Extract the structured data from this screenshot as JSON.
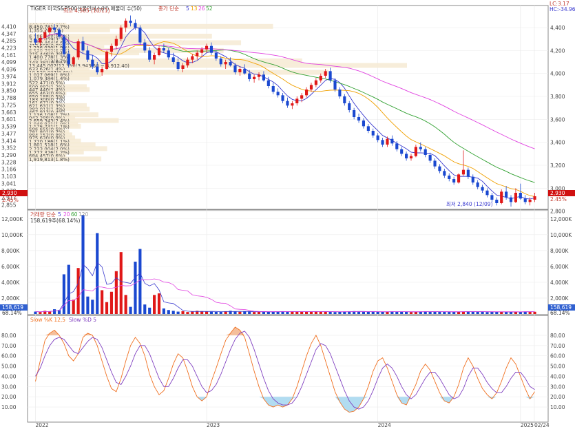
{
  "chart_data": {
    "type": "candlestick",
    "title": "TIGER 미국S&P500선물인버스(H) 매물대 수(50)",
    "price_legend": {
      "label": "종가 단순",
      "periods": [
        "5",
        "13",
        "26",
        "52"
      ]
    },
    "corner_info": {
      "lc": "LC:3.17",
      "hc": "HC:-34.96"
    },
    "price_axis": {
      "ylim": [
        2840,
        4520
      ],
      "right_ticks": [
        "4,400",
        "4,200",
        "4,000",
        "3,800",
        "3,600",
        "3,400",
        "3,200",
        "3,000",
        "2,800"
      ],
      "left_ticks": [
        "4,410",
        "4,347",
        "4,285",
        "4,223",
        "4,161",
        "4,099",
        "4,036",
        "3,974",
        "3,912",
        "3,850",
        "3,788",
        "3,725",
        "3,663",
        "3,601",
        "3,539",
        "3,477",
        "3,414",
        "3,352",
        "3,290",
        "3,228",
        "3,166",
        "3,103",
        "3,041",
        "2,979",
        "2,917",
        "2,855"
      ],
      "current_price_badge": "2,930",
      "current_change": "2.45%"
    },
    "x_axis": {
      "labels": [
        "2022",
        "2023",
        "2024",
        "2025",
        "02/24"
      ]
    },
    "annotations": {
      "high": "최고 4,505 (10/11)",
      "low": "최저 2,840 (12/09)"
    },
    "volume_profile": [
      {
        "price": 4420,
        "text": "402,150(0.6%)"
      },
      {
        "price": 4380,
        "text": "1,355,7(2.1%)"
      },
      {
        "price": 4410,
        "text": "8,450,781(7.7%)"
      },
      {
        "price": 4325,
        "text": "6,185,468(5.6%)"
      },
      {
        "price": 4300,
        "text": "3,422,059(3.3%)"
      },
      {
        "price": 4268,
        "text": "7,199,464(6.6%)"
      },
      {
        "price": 4245,
        "text": "413,609(0.6%)"
      },
      {
        "price": 4225,
        "text": "1,236,030(1.9%)"
      },
      {
        "price": 4200,
        "text": "6,530,782(6.0%)"
      },
      {
        "price": 4180,
        "text": "3,450,448(3.1%)"
      },
      {
        "price": 4170,
        "text": "315,446(0.3%)"
      },
      {
        "price": 4145,
        "text": "1,400,778(1.3%)"
      },
      {
        "price": 4110,
        "text": "9,525,583(8.7%)"
      },
      {
        "price": 4098,
        "text": "143,381(0.1%)"
      },
      {
        "price": 4070,
        "text": "13,445,002(12.3%)(3,943.50 ~ 3,912.40)"
      },
      {
        "price": 4040,
        "text": "633,626(1.4%)"
      },
      {
        "price": 4010,
        "text": "10,520,037(9.6%)"
      },
      {
        "price": 3990,
        "text": "1,027,069(1.8%)"
      },
      {
        "price": 3960,
        "text": "1,079,384(1.4%)"
      },
      {
        "price": 3920,
        "text": "522,471(0.5%)"
      },
      {
        "price": 3885,
        "text": "500,882(1.3%)"
      },
      {
        "price": 3860,
        "text": "447,440(1.4%)"
      },
      {
        "price": 3830,
        "text": "655,463(0.6%)"
      },
      {
        "price": 3800,
        "text": "650,188(0.5%)"
      },
      {
        "price": 3775,
        "text": "183,300(0.2%)"
      },
      {
        "price": 3745,
        "text": "161,671(0.3%)"
      },
      {
        "price": 3720,
        "text": "621,631(1.3%)"
      },
      {
        "price": 3690,
        "text": "382,013(1.4%)"
      },
      {
        "price": 3665,
        "text": "467,913(0.4%)"
      },
      {
        "price": 3640,
        "text": "1,136,108(1.7%)"
      },
      {
        "price": 3615,
        "text": "943,388(0.9%)"
      },
      {
        "price": 3590,
        "text": "2,659,343(2.4%)"
      },
      {
        "price": 3560,
        "text": "1,048,931(1.0%)"
      },
      {
        "price": 3540,
        "text": "1,176,731(1.1%)"
      },
      {
        "price": 3515,
        "text": "596,655(0.5%)"
      },
      {
        "price": 3490,
        "text": "781,801(0.7%)"
      },
      {
        "price": 3465,
        "text": "884,153(0.8%)"
      },
      {
        "price": 3440,
        "text": "975,630(0.9%)"
      },
      {
        "price": 3410,
        "text": "1,220,186(1.1%)"
      },
      {
        "price": 3380,
        "text": "1,801,518(1.6%)"
      },
      {
        "price": 3345,
        "text": "2,233,004(2.0%)"
      },
      {
        "price": 3315,
        "text": "1,272,326(1.2%)"
      },
      {
        "price": 3285,
        "text": "684,457(0.6%)"
      },
      {
        "price": 3255,
        "text": "1,919,813(1.8%)"
      }
    ],
    "ma_series": [
      {
        "name": "5",
        "color": "#3a3acf"
      },
      {
        "name": "13",
        "color": "#f0a000"
      },
      {
        "name": "26",
        "color": "#30a030"
      },
      {
        "name": "52",
        "color": "#e040e0"
      }
    ],
    "volume": {
      "legend": {
        "label": "거래량 단순",
        "periods": [
          "5",
          "20",
          "60",
          "120"
        ]
      },
      "current": "158,619주(68.14%)",
      "badge": "158,619",
      "badge_pct": "68.14%",
      "ylim": [
        0,
        12500
      ],
      "ticks": [
        "12,000K",
        "10,000K",
        "8,000K",
        "6,000K",
        "4,000K",
        "2,000K"
      ]
    },
    "stochastic": {
      "legend": {
        "k_label": "Slow %K 12,5",
        "d_label": "Slow %D 5"
      },
      "ylim": [
        0,
        90
      ],
      "ticks": [
        "80.00",
        "70.00",
        "60.00",
        "50.00",
        "40.00",
        "30.00",
        "20.00",
        "10.00"
      ]
    },
    "candles": [
      [
        4300,
        4350,
        4250,
        4270
      ],
      [
        4270,
        4330,
        4240,
        4310
      ],
      [
        4310,
        4380,
        4290,
        4360
      ],
      [
        4360,
        4420,
        4330,
        4400
      ],
      [
        4400,
        4430,
        4350,
        4380
      ],
      [
        4380,
        4400,
        4300,
        4320
      ],
      [
        4320,
        4340,
        4150,
        4170
      ],
      [
        4170,
        4200,
        4050,
        4080
      ],
      [
        4080,
        4150,
        4060,
        4140
      ],
      [
        4140,
        4300,
        4120,
        4280
      ],
      [
        4280,
        4320,
        4180,
        4200
      ],
      [
        4200,
        4240,
        4100,
        4120
      ],
      [
        4120,
        4160,
        4040,
        4060
      ],
      [
        4060,
        4100,
        3990,
        4010
      ],
      [
        4010,
        4060,
        3980,
        4040
      ],
      [
        4040,
        4200,
        4030,
        4190
      ],
      [
        4190,
        4260,
        4150,
        4240
      ],
      [
        4240,
        4330,
        4210,
        4300
      ],
      [
        4300,
        4420,
        4280,
        4400
      ],
      [
        4400,
        4480,
        4360,
        4460
      ],
      [
        4460,
        4505,
        4410,
        4440
      ],
      [
        4440,
        4470,
        4380,
        4400
      ],
      [
        4400,
        4420,
        4250,
        4270
      ],
      [
        4270,
        4300,
        4180,
        4200
      ],
      [
        4200,
        4230,
        4100,
        4120
      ],
      [
        4120,
        4180,
        4080,
        4160
      ],
      [
        4160,
        4240,
        4150,
        4220
      ],
      [
        4220,
        4260,
        4180,
        4200
      ],
      [
        4200,
        4220,
        4120,
        4140
      ],
      [
        4140,
        4180,
        4080,
        4100
      ],
      [
        4100,
        4130,
        4020,
        4040
      ],
      [
        4040,
        4090,
        4010,
        4070
      ],
      [
        4070,
        4140,
        4050,
        4120
      ],
      [
        4120,
        4170,
        4090,
        4150
      ],
      [
        4150,
        4200,
        4120,
        4180
      ],
      [
        4180,
        4230,
        4140,
        4210
      ],
      [
        4210,
        4260,
        4180,
        4240
      ],
      [
        4240,
        4270,
        4160,
        4180
      ],
      [
        4180,
        4200,
        4110,
        4130
      ],
      [
        4130,
        4150,
        4060,
        4080
      ],
      [
        4080,
        4120,
        4040,
        4100
      ],
      [
        4100,
        4140,
        4060,
        4070
      ],
      [
        4070,
        4090,
        3990,
        4010
      ],
      [
        4010,
        4060,
        3980,
        4040
      ],
      [
        4040,
        4080,
        3990,
        4000
      ],
      [
        4000,
        4030,
        3930,
        3950
      ],
      [
        3950,
        3990,
        3920,
        3970
      ],
      [
        3970,
        4010,
        3940,
        3990
      ],
      [
        3990,
        4020,
        3930,
        3940
      ],
      [
        3940,
        3970,
        3870,
        3890
      ],
      [
        3890,
        3920,
        3820,
        3840
      ],
      [
        3840,
        3870,
        3790,
        3810
      ],
      [
        3810,
        3830,
        3740,
        3760
      ],
      [
        3760,
        3790,
        3700,
        3720
      ],
      [
        3720,
        3760,
        3690,
        3740
      ],
      [
        3740,
        3800,
        3720,
        3780
      ],
      [
        3780,
        3830,
        3750,
        3810
      ],
      [
        3810,
        3880,
        3790,
        3860
      ],
      [
        3860,
        3920,
        3840,
        3900
      ],
      [
        3900,
        3960,
        3880,
        3940
      ],
      [
        3940,
        4000,
        3920,
        3980
      ],
      [
        3980,
        4040,
        3960,
        4020
      ],
      [
        4020,
        4050,
        3920,
        3940
      ],
      [
        3940,
        3960,
        3840,
        3860
      ],
      [
        3860,
        3880,
        3780,
        3800
      ],
      [
        3800,
        3820,
        3720,
        3740
      ],
      [
        3740,
        3760,
        3660,
        3680
      ],
      [
        3680,
        3700,
        3600,
        3620
      ],
      [
        3620,
        3650,
        3570,
        3590
      ],
      [
        3590,
        3610,
        3520,
        3540
      ],
      [
        3540,
        3560,
        3480,
        3500
      ],
      [
        3500,
        3520,
        3440,
        3460
      ],
      [
        3460,
        3480,
        3400,
        3420
      ],
      [
        3420,
        3440,
        3360,
        3380
      ],
      [
        3380,
        3450,
        3360,
        3430
      ],
      [
        3430,
        3460,
        3370,
        3390
      ],
      [
        3390,
        3410,
        3320,
        3340
      ],
      [
        3340,
        3360,
        3280,
        3300
      ],
      [
        3300,
        3320,
        3240,
        3260
      ],
      [
        3260,
        3300,
        3240,
        3280
      ],
      [
        3280,
        3380,
        3270,
        3360
      ],
      [
        3360,
        3400,
        3320,
        3340
      ],
      [
        3340,
        3360,
        3270,
        3290
      ],
      [
        3290,
        3310,
        3220,
        3240
      ],
      [
        3240,
        3260,
        3170,
        3190
      ],
      [
        3190,
        3210,
        3130,
        3150
      ],
      [
        3150,
        3170,
        3090,
        3110
      ],
      [
        3110,
        3130,
        3060,
        3080
      ],
      [
        3080,
        3100,
        3030,
        3050
      ],
      [
        3050,
        3130,
        3040,
        3120
      ],
      [
        3120,
        3330,
        3110,
        3160
      ],
      [
        3160,
        3180,
        3080,
        3100
      ],
      [
        3100,
        3120,
        3030,
        3050
      ],
      [
        3050,
        3070,
        2990,
        3010
      ],
      [
        3010,
        3030,
        2960,
        2980
      ],
      [
        2980,
        3000,
        2920,
        2940
      ],
      [
        2940,
        2960,
        2880,
        2900
      ],
      [
        2900,
        2920,
        2850,
        2870
      ],
      [
        2870,
        2990,
        2860,
        2970
      ],
      [
        2970,
        3020,
        2900,
        2920
      ],
      [
        2920,
        2940,
        2840,
        2880
      ],
      [
        2880,
        3000,
        2870,
        2960
      ],
      [
        2960,
        3040,
        2900,
        2910
      ],
      [
        2910,
        2940,
        2860,
        2880
      ],
      [
        2880,
        2920,
        2850,
        2900
      ],
      [
        2900,
        2960,
        2880,
        2930
      ]
    ],
    "volumes": [
      300,
      250,
      400,
      350,
      600,
      500,
      5000,
      6200,
      1800,
      5800,
      12500,
      2200,
      1800,
      10200,
      3000,
      1500,
      2800,
      5400,
      7800,
      2400,
      900,
      6600,
      8200,
      1200,
      800,
      2400,
      2600,
      700,
      500,
      400,
      300,
      350,
      250,
      300,
      400,
      350,
      300,
      280,
      260,
      300,
      350,
      400,
      300,
      280,
      320,
      300,
      250,
      280,
      300,
      260,
      280,
      300,
      350,
      320,
      300,
      280,
      260,
      300,
      320,
      350,
      300,
      280,
      260,
      240,
      300,
      320,
      340,
      360,
      300,
      280,
      260,
      300,
      280,
      260,
      300,
      320,
      300,
      280,
      260,
      240,
      300,
      320,
      340,
      300,
      280,
      260,
      300,
      280,
      260,
      300,
      320,
      340,
      300,
      280,
      260,
      240,
      300,
      280,
      260,
      240,
      260,
      280,
      300,
      320,
      300,
      280,
      260,
      240,
      220,
      200,
      158
    ],
    "stoch_k": [
      35,
      55,
      75,
      82,
      85,
      80,
      72,
      60,
      55,
      62,
      78,
      82,
      80,
      70,
      55,
      40,
      28,
      25,
      38,
      55,
      70,
      78,
      72,
      60,
      42,
      30,
      22,
      26,
      38,
      52,
      62,
      58,
      45,
      30,
      20,
      16,
      20,
      35,
      48,
      62,
      75,
      82,
      88,
      85,
      78,
      62,
      45,
      30,
      18,
      12,
      10,
      12,
      10,
      12,
      18,
      30,
      45,
      60,
      72,
      80,
      70,
      55,
      40,
      25,
      15,
      8,
      5,
      6,
      10,
      18,
      30,
      45,
      55,
      58,
      48,
      35,
      22,
      14,
      12,
      22,
      32,
      45,
      52,
      46,
      35,
      24,
      16,
      14,
      20,
      32,
      48,
      58,
      50,
      38,
      28,
      22,
      18,
      24,
      35,
      48,
      58,
      52,
      40,
      28,
      18,
      25,
      28
    ],
    "stoch_d": [
      40,
      48,
      60,
      70,
      76,
      78,
      76,
      70,
      64,
      62,
      68,
      74,
      78,
      76,
      68,
      56,
      44,
      34,
      32,
      40,
      50,
      62,
      70,
      70,
      62,
      50,
      38,
      30,
      30,
      38,
      48,
      56,
      56,
      50,
      40,
      30,
      24,
      26,
      32,
      42,
      54,
      66,
      76,
      82,
      84,
      78,
      66,
      52,
      38,
      26,
      18,
      14,
      12,
      12,
      14,
      20,
      30,
      42,
      54,
      66,
      72,
      70,
      62,
      50,
      38,
      26,
      16,
      10,
      8,
      10,
      16,
      26,
      38,
      48,
      52,
      48,
      40,
      30,
      22,
      18,
      22,
      30,
      38,
      44,
      44,
      38,
      30,
      22,
      18,
      20,
      28,
      40,
      48,
      48,
      42,
      34,
      28,
      24,
      24,
      30,
      38,
      44,
      44,
      38,
      30,
      27,
      26
    ]
  }
}
